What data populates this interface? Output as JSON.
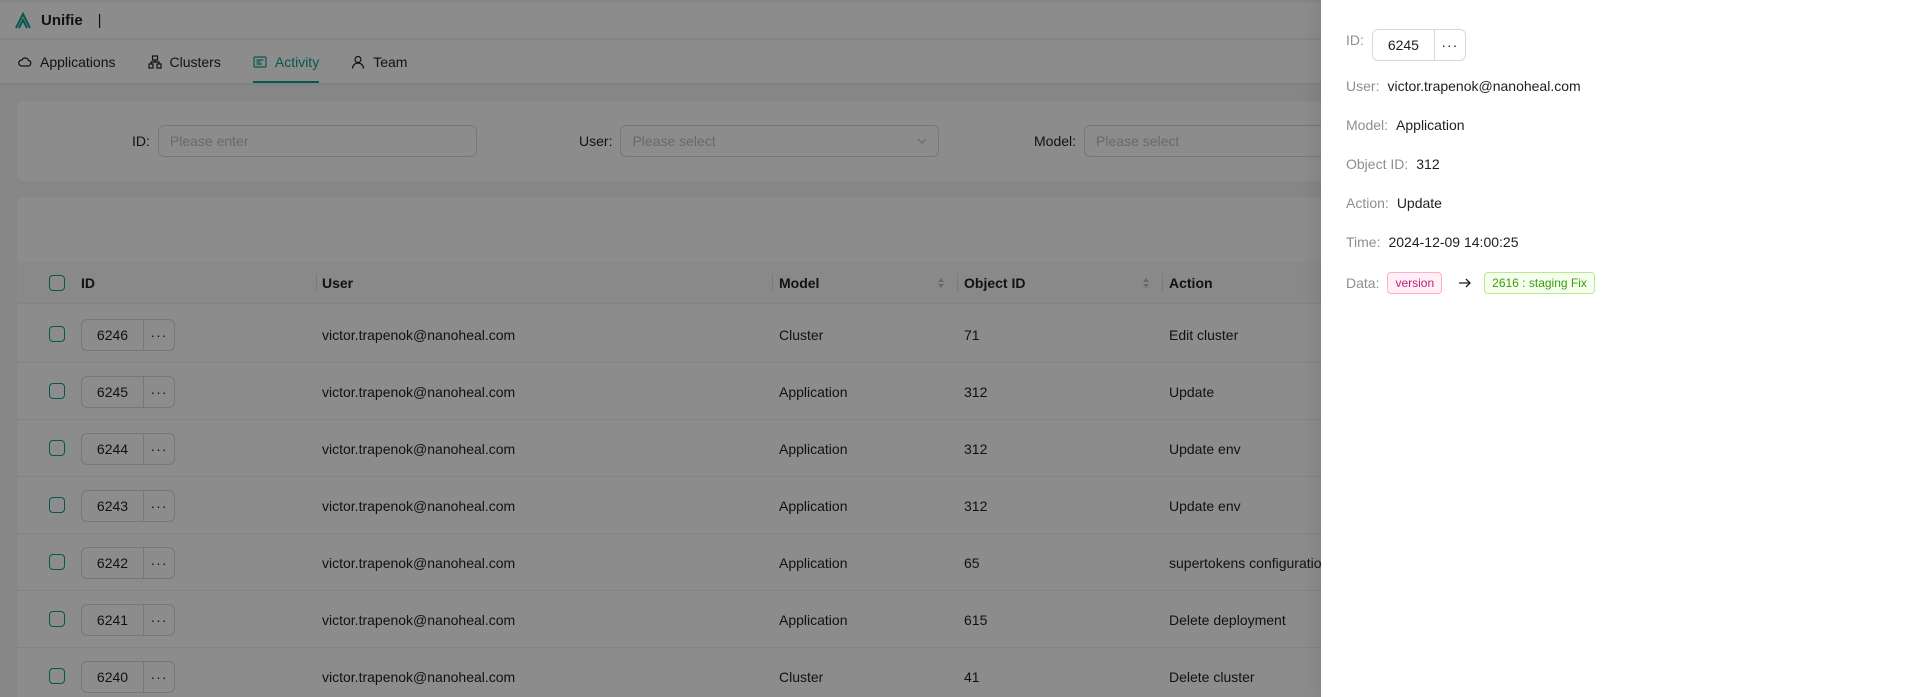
{
  "header": {
    "brand": "Unifie",
    "separator": "|"
  },
  "nav": [
    {
      "label": "Applications",
      "icon": "cloud-icon"
    },
    {
      "label": "Clusters",
      "icon": "cluster-icon"
    },
    {
      "label": "Activity",
      "icon": "activity-icon",
      "active": true
    },
    {
      "label": "Team",
      "icon": "user-icon"
    }
  ],
  "filters": {
    "id": {
      "label": "ID",
      "placeholder": "Please enter"
    },
    "user": {
      "label": "User",
      "placeholder": "Please select"
    },
    "model": {
      "label": "Model",
      "placeholder": "Please select"
    }
  },
  "table": {
    "columns": [
      "ID",
      "User",
      "Model",
      "Object ID",
      "Action"
    ],
    "rows": [
      {
        "id": "6246",
        "user": "victor.trapenok@nanoheal.com",
        "model": "Cluster",
        "object_id": "71",
        "action": "Edit cluster"
      },
      {
        "id": "6245",
        "user": "victor.trapenok@nanoheal.com",
        "model": "Application",
        "object_id": "312",
        "action": "Update"
      },
      {
        "id": "6244",
        "user": "victor.trapenok@nanoheal.com",
        "model": "Application",
        "object_id": "312",
        "action": "Update env"
      },
      {
        "id": "6243",
        "user": "victor.trapenok@nanoheal.com",
        "model": "Application",
        "object_id": "312",
        "action": "Update env"
      },
      {
        "id": "6242",
        "user": "victor.trapenok@nanoheal.com",
        "model": "Application",
        "object_id": "65",
        "action": "supertokens configuratio"
      },
      {
        "id": "6241",
        "user": "victor.trapenok@nanoheal.com",
        "model": "Application",
        "object_id": "615",
        "action": "Delete deployment"
      },
      {
        "id": "6240",
        "user": "victor.trapenok@nanoheal.com",
        "model": "Cluster",
        "object_id": "41",
        "action": "Delete cluster"
      }
    ],
    "more_label": "···"
  },
  "drawer": {
    "id_label": "ID",
    "id_value": "6245",
    "more_label": "···",
    "user_label": "User",
    "user_value": "victor.trapenok@nanoheal.com",
    "model_label": "Model",
    "model_value": "Application",
    "object_id_label": "Object ID",
    "object_id_value": "312",
    "action_label": "Action",
    "action_value": "Update",
    "time_label": "Time",
    "time_value": "2024-12-09 14:00:25",
    "data_label": "Data",
    "data_key": "version",
    "data_new": "2616 : staging Fix"
  },
  "colors": {
    "accent": "#0e9f8a",
    "tag_magenta": "#c41d7f",
    "tag_green": "#389e0d"
  }
}
